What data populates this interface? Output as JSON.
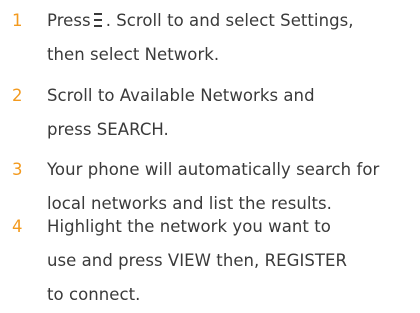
{
  "steps": [
    {
      "number": "1",
      "lines": [
        "Press",
        ". Scroll to and select Settings,",
        "then select Network."
      ],
      "icon": "menu-icon"
    },
    {
      "number": "2",
      "lines": [
        "Scroll to Available Networks and",
        "press SEARCH."
      ]
    },
    {
      "number": "3",
      "lines": [
        "Your phone will automatically search for",
        "local networks and list the results."
      ]
    },
    {
      "number": "4",
      "lines": [
        "Highlight the network you want to",
        "use and press VIEW then, REGISTER",
        "to connect."
      ]
    }
  ],
  "colors": {
    "number": "#f39a1e",
    "text": "#3a3a3a"
  }
}
